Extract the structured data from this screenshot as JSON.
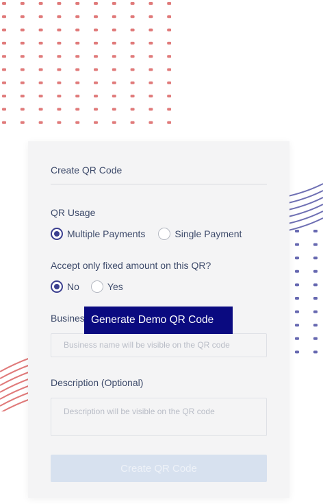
{
  "card": {
    "title": "Create QR Code",
    "qr_usage": {
      "label": "QR Usage",
      "options": [
        "Multiple Payments",
        "Single Payment"
      ],
      "selected": "Multiple Payments"
    },
    "fixed_amount": {
      "label": "Accept only fixed amount on this QR?",
      "options": [
        "No",
        "Yes"
      ],
      "selected": "No"
    },
    "business_name": {
      "label": "Business",
      "placeholder": "Business name will be visible on the QR code"
    },
    "description": {
      "label": "Description (Optional)",
      "placeholder": "Description will be visible on the QR code"
    },
    "create_button_label": "Create QR Code"
  },
  "demo_button_label": "Generate Demo QR Code",
  "colors": {
    "accent": "#3b3f8f",
    "demo_button": "#0a0a80",
    "dots_top": "#e07a7a",
    "dots_right": "#6668b0",
    "waves_right": "#6e6fb3",
    "waves_left": "#e07a7a"
  }
}
